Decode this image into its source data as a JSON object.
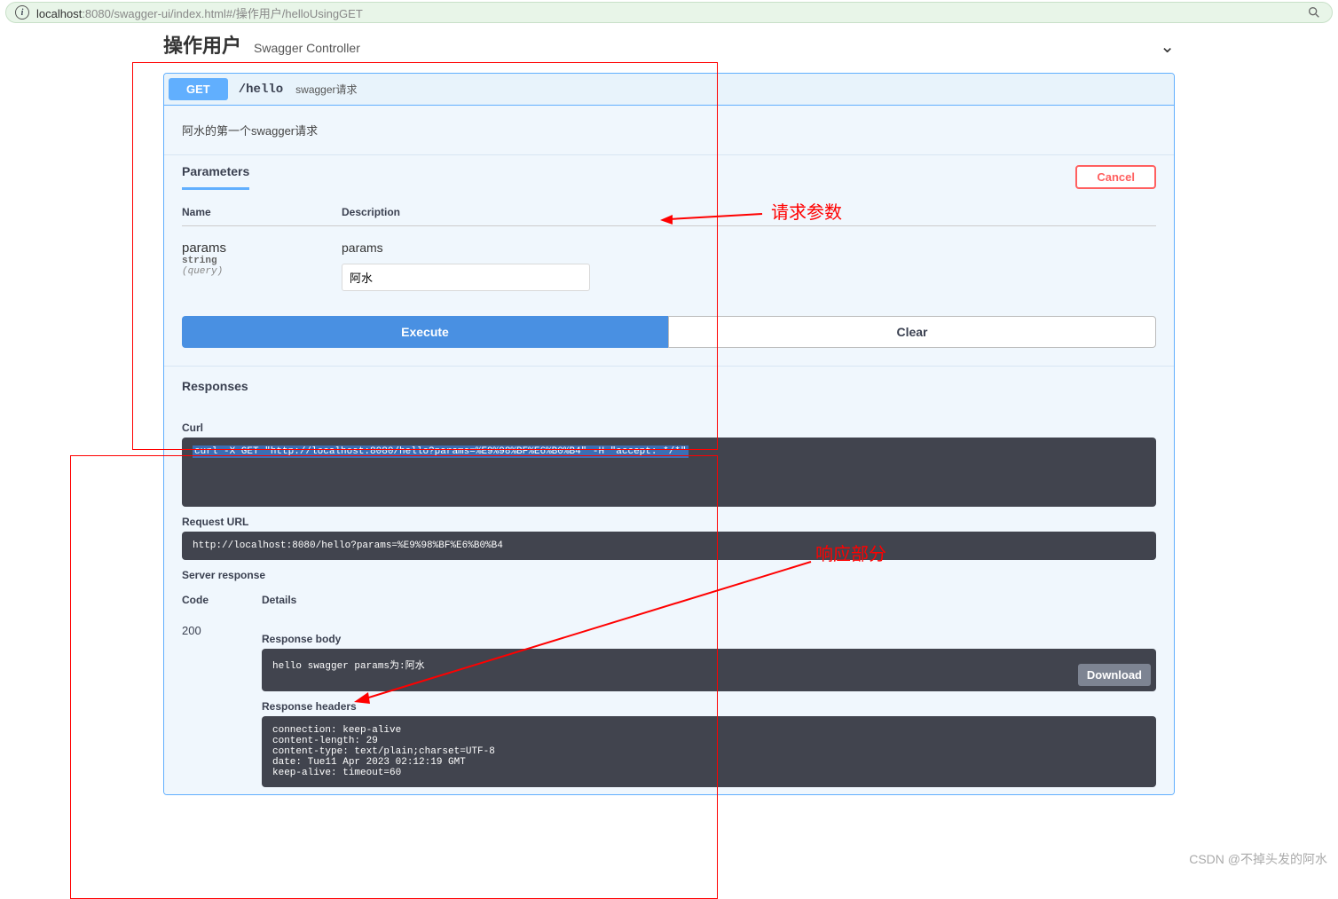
{
  "url": {
    "host": "localhost",
    "rest": ":8080/swagger-ui/index.html#/操作用户/helloUsingGET"
  },
  "section": {
    "tag": "操作用户",
    "desc": "Swagger Controller"
  },
  "operation": {
    "method": "GET",
    "path": "/hello",
    "summary": "swagger请求",
    "description": "阿水的第一个swagger请求"
  },
  "parameters": {
    "title": "Parameters",
    "cancel": "Cancel",
    "headers": {
      "name": "Name",
      "desc": "Description"
    },
    "items": [
      {
        "name": "params",
        "type": "string",
        "in": "(query)",
        "desc": "params",
        "value": "阿水"
      }
    ]
  },
  "buttons": {
    "execute": "Execute",
    "clear": "Clear"
  },
  "responses": {
    "title": "Responses",
    "curl_label": "Curl",
    "curl": "curl -X GET \"http://localhost:8080/hello?params=%E9%98%BF%E6%B0%B4\" -H \"accept: */*\"",
    "request_url_label": "Request URL",
    "request_url": "http://localhost:8080/hello?params=%E9%98%BF%E6%B0%B4",
    "server_response_label": "Server response",
    "code_header": "Code",
    "details_header": "Details",
    "code": "200",
    "body_label": "Response body",
    "body": "hello swagger params为:阿水",
    "download": "Download",
    "headers_label": "Response headers",
    "headers_text": "connection: keep-alive\ncontent-length: 29\ncontent-type: text/plain;charset=UTF-8\ndate: Tue11 Apr 2023 02:12:19 GMT\nkeep-alive: timeout=60"
  },
  "annotations": {
    "req": "请求参数",
    "resp": "响应部分"
  },
  "watermark": "CSDN @不掉头发的阿水"
}
